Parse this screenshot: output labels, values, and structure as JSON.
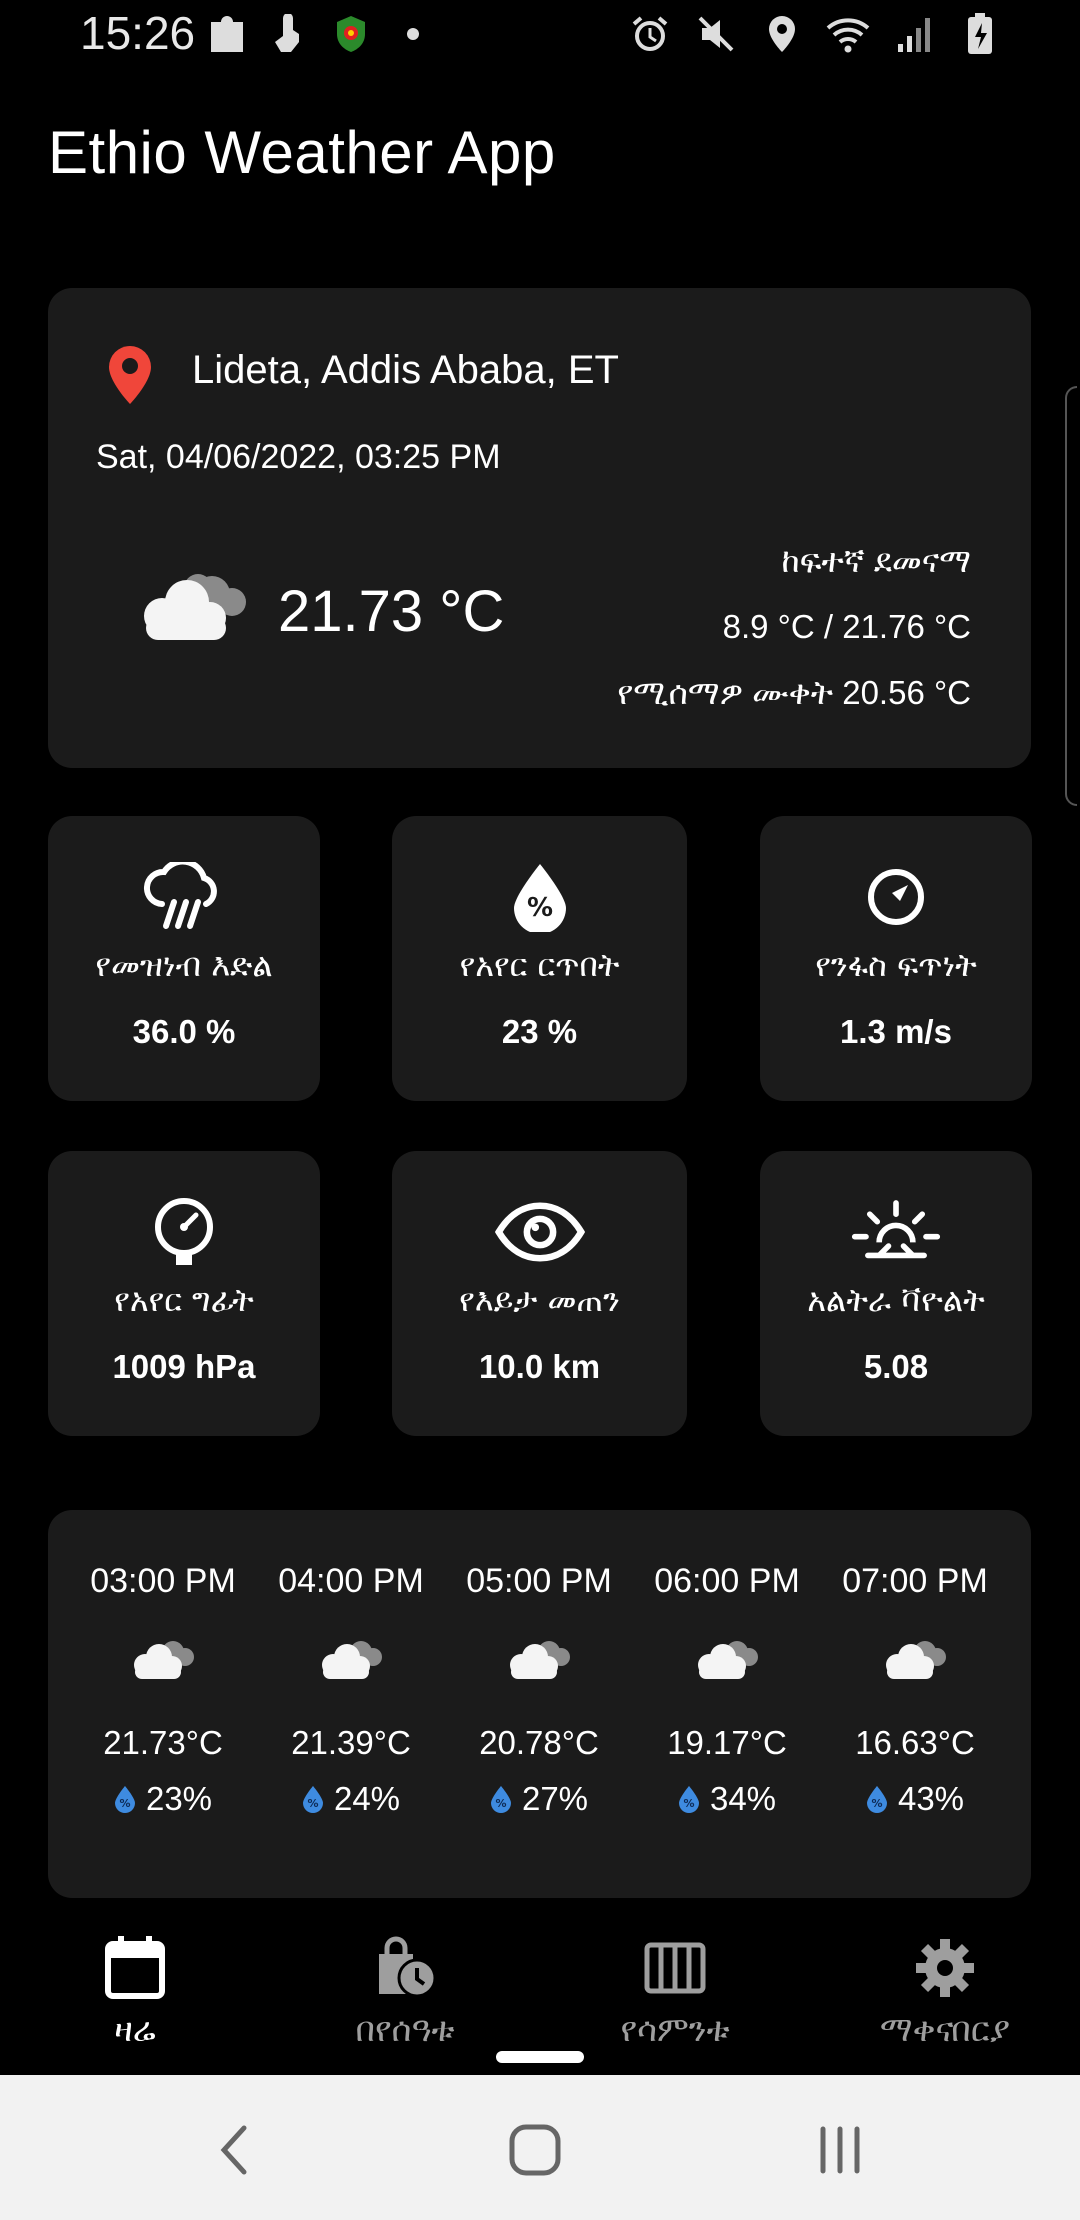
{
  "status_bar": {
    "time": "15:26",
    "left_icons": [
      "puzzle-icon",
      "hand-icon",
      "shield-icon",
      "dot-icon"
    ],
    "right_icons": [
      "alarm-icon",
      "mute-icon",
      "location-icon",
      "wifi-icon",
      "signal-icon",
      "battery-icon"
    ]
  },
  "app": {
    "title": "Ethio Weather App"
  },
  "current": {
    "location": "Lideta, Addis Ababa, ET",
    "datetime": "Sat, 04/06/2022, 03:25 PM",
    "temperature": "21.73 °C",
    "condition_icon": "cloudy-icon",
    "high_low_label": "ከፍተኛ ደመናማ",
    "min_max": "8.9 °C / 21.76 °C",
    "feels_like": "የሚሰማዎ ሙቀት 20.56 °C"
  },
  "metrics": [
    {
      "icon": "rain-cloud-icon",
      "label": "የመዝነብ እድል",
      "value": "36.0 %"
    },
    {
      "icon": "humidity-drop-icon",
      "label": "የአየር ርጥበት",
      "value": "23 %"
    },
    {
      "icon": "compass-icon",
      "label": "የንፋስ ፍጥነት",
      "value": "1.3 m/s"
    },
    {
      "icon": "gauge-icon",
      "label": "የአየር ግፊት",
      "value": "1009 hPa"
    },
    {
      "icon": "eye-icon",
      "label": "የእይታ መጠን",
      "value": "10.0 km"
    },
    {
      "icon": "sun-icon",
      "label": "አልትራ ቫዮልት",
      "value": "5.08"
    }
  ],
  "hourly": [
    {
      "time": "03:00 PM",
      "temp": "21.73°C",
      "humidity": "23%"
    },
    {
      "time": "04:00 PM",
      "temp": "21.39°C",
      "humidity": "24%"
    },
    {
      "time": "05:00 PM",
      "temp": "20.78°C",
      "humidity": "27%"
    },
    {
      "time": "06:00 PM",
      "temp": "19.17°C",
      "humidity": "34%"
    },
    {
      "time": "07:00 PM",
      "temp": "16.63°C",
      "humidity": "43%"
    }
  ],
  "nav": [
    {
      "icon": "calendar-icon",
      "label": "ዛሬ",
      "active": true
    },
    {
      "icon": "hourly-clock-icon",
      "label": "በየሰዓቱ",
      "active": false
    },
    {
      "icon": "week-columns-icon",
      "label": "የሳምንቱ",
      "active": false
    },
    {
      "icon": "settings-gear-icon",
      "label": "ማቀናበርያ",
      "active": false
    }
  ],
  "colors": {
    "background": "#000000",
    "card": "#1b1b1b",
    "pin": "#f0463a",
    "drop": "#3e8be0",
    "nav_inactive": "#9e9e9e"
  }
}
